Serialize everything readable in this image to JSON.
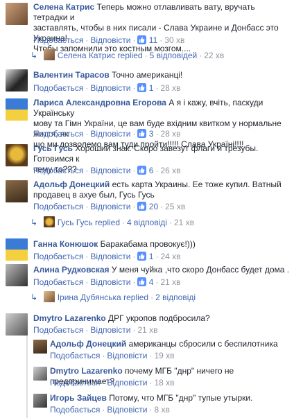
{
  "ui": {
    "like": "Подобається",
    "reply": "Відповісти",
    "replied": "replied",
    "sep": "·"
  },
  "comments": [
    {
      "name": "Селена Катрис",
      "text1": "Теперь можно отлавливать вату, вручать тетрадки и",
      "text2": "заставлять, чтобы в них писали - Слава Украине и Донбасс это Украина!",
      "text3": "Чтобы запомнили это костным мозгом....",
      "likes": "11",
      "time": "30 хв",
      "replies": {
        "name": "Селена Катрис",
        "count": "5 відповідей",
        "time": "22 хв"
      }
    },
    {
      "name": "Валентин Тарасов",
      "text1": "Точно американці!",
      "likes": "1",
      "time": "28 хв"
    },
    {
      "name": "Лариса Александровна Егорова",
      "text1": "А я і кажу, вчіть, паскуди Українську",
      "text2": "мову та Гімн України, це вам буде вхідним квитком у нормальне життя, як",
      "text3": "що ми дозволемо вам туди пройти!!!!! Слава Україні!!!!",
      "likes": "3",
      "time": "28 хв"
    },
    {
      "name": "Гусь Гусь",
      "text1": "Хороший знак. Скоро завезут флаги и трезубы. Готовимся к",
      "text2": "чему то???",
      "likes": "6",
      "time": "26 хв"
    },
    {
      "name": "Адольф Донецкий",
      "text1": "есть карта Украины. Ее тоже купил. Ватный",
      "text2": "продавец в ахуе был, Гусь Гусь",
      "likes": "20",
      "time": "25 хв",
      "replies": {
        "name": "Гусь Гусь",
        "count": "4 відповіді",
        "time": "21 хв"
      }
    },
    {
      "name": "Ганна Конюшок",
      "text1": "Баракабама провокує!)))",
      "likes": "1",
      "time": "24 хв"
    },
    {
      "name": "Алина Рудковская",
      "text1": "У меня чуйка ,что скоро Донбасс будет дома .",
      "likes": "4",
      "time": "21 хв",
      "replies": {
        "name": "Ірина Дубянська",
        "count": "2 відповіді",
        "time": ""
      }
    },
    {
      "name": "Dmytro Lazarenko",
      "text1": "ДРГ укропов подбросила?",
      "time": "21 хв"
    }
  ],
  "nested": [
    {
      "name": "Адольф Донецкий",
      "text1": "американцы сбросили с беспилотника",
      "time": "19 хв"
    },
    {
      "name": "Dmytro Lazarenko",
      "text1": "почему МГБ \"днр\" ничего не предпринимает?",
      "time": "18 хв"
    },
    {
      "name": "Игорь Зайцев",
      "text1": "Потому, что МГБ \"днр\" тупые утырки.",
      "time": "8 хв"
    }
  ]
}
